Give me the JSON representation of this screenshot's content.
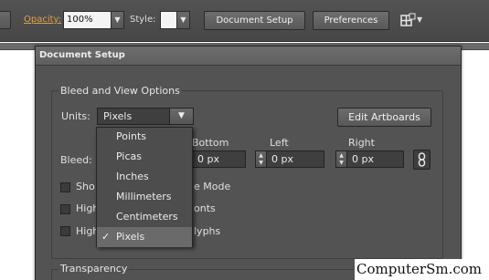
{
  "control_bar": {
    "opacity_label": "Opacity:",
    "opacity_value": "100%",
    "style_label": "Style:",
    "document_setup_button": "Document Setup",
    "preferences_button": "Preferences",
    "arrange_icon": "arrange-documents-icon"
  },
  "dialog": {
    "title": "Document Setup",
    "bleed_group": {
      "title": "Bleed and View Options",
      "units_label": "Units:",
      "units_value": "Pixels",
      "edit_artboards_button": "Edit Artboards",
      "bleed_label": "Bleed:",
      "columns": [
        {
          "label": "Bottom",
          "value": "0 px"
        },
        {
          "label": "Left",
          "value": "0 px"
        },
        {
          "label": "Right",
          "value": "0 px"
        }
      ],
      "link_icon": "chain-link-icon",
      "options": [
        {
          "prefix": "Sho",
          "suffix": "e Mode"
        },
        {
          "prefix": "High",
          "suffix": "onts"
        },
        {
          "prefix": "High",
          "suffix": "lyphs"
        }
      ]
    },
    "transparency_title": "Transparency"
  },
  "units_dropdown": {
    "items": [
      "Points",
      "Picas",
      "Inches",
      "Millimeters",
      "Centimeters",
      "Pixels"
    ],
    "selected": "Pixels",
    "check_mark": "✓"
  },
  "watermark": "ComputerSm.com",
  "colors": {
    "toolbar": "#4d4d4d",
    "dialog": "#535353",
    "field": "#3f3f3f",
    "opacity_label": "#e0a04a"
  }
}
